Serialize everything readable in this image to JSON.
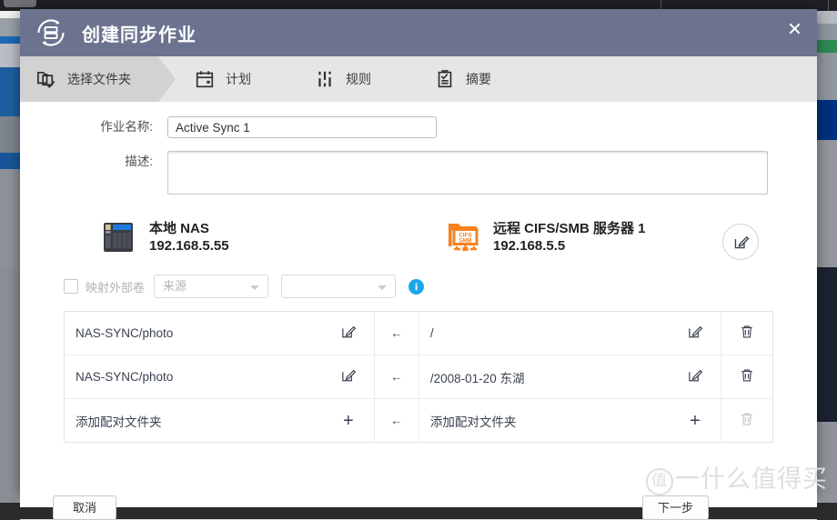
{
  "window": {
    "title": "创建同步作业",
    "title_icon": "sync-nas-icon",
    "close_icon": "close-icon"
  },
  "steps": [
    {
      "label": "选择文件夹",
      "icon": "folder-check-icon",
      "active": true
    },
    {
      "label": "计划",
      "icon": "calendar-icon",
      "active": false
    },
    {
      "label": "规则",
      "icon": "sliders-icon",
      "active": false
    },
    {
      "label": "摘要",
      "icon": "clipboard-check-icon",
      "active": false
    }
  ],
  "form": {
    "job_name_label": "作业名称:",
    "job_name_value": "Active Sync 1",
    "job_name_placeholder": "",
    "description_label": "描述:",
    "description_value": "",
    "description_placeholder": ""
  },
  "endpoints": {
    "local": {
      "icon": "nas-device-icon",
      "name": "本地 NAS",
      "address": "192.168.5.55"
    },
    "remote": {
      "icon": "cifs-smb-folder-icon",
      "name": "远程 CIFS/SMB 服务器 1",
      "address": "192.168.5.5"
    },
    "edit_icon": "edit-pencil-icon"
  },
  "map_volume": {
    "checkbox_checked": false,
    "label": "映射外部卷",
    "source_select_value": "来源",
    "target_select_value": "",
    "info_icon": "info-icon",
    "caret_icon": "chevron-down-icon"
  },
  "pair_table": {
    "arrow_icon": "arrow-left-icon",
    "edit_icon": "edit-pencil-icon",
    "delete_icon": "trash-icon",
    "add_icon": "plus-icon",
    "rows": [
      {
        "left_path": "NAS-SYNC/photo",
        "left_action": "edit",
        "arrow": "←",
        "right_path": "/",
        "right_action": "edit",
        "deletable": true,
        "is_add_row": false
      },
      {
        "left_path": "NAS-SYNC/photo",
        "left_action": "edit",
        "arrow": "←",
        "right_path": "/2008-01-20 东湖",
        "right_action": "edit",
        "deletable": true,
        "is_add_row": false
      },
      {
        "left_path": "添加配对文件夹",
        "left_action": "add",
        "arrow": "←",
        "right_path": "添加配对文件夹",
        "right_action": "add",
        "deletable": false,
        "is_add_row": true
      }
    ]
  },
  "footer": {
    "cancel_label": "取消",
    "next_label": "下一步"
  },
  "watermark": {
    "mark": "值",
    "text": "一什么值得买"
  },
  "colors": {
    "titlebar": "#6b738f",
    "step_bar": "#e6e6e6",
    "step_active": "#d2d2d2",
    "accent_orange": "#f58220",
    "info_blue": "#1ca7ea",
    "table_border": "#dfe3e8"
  }
}
